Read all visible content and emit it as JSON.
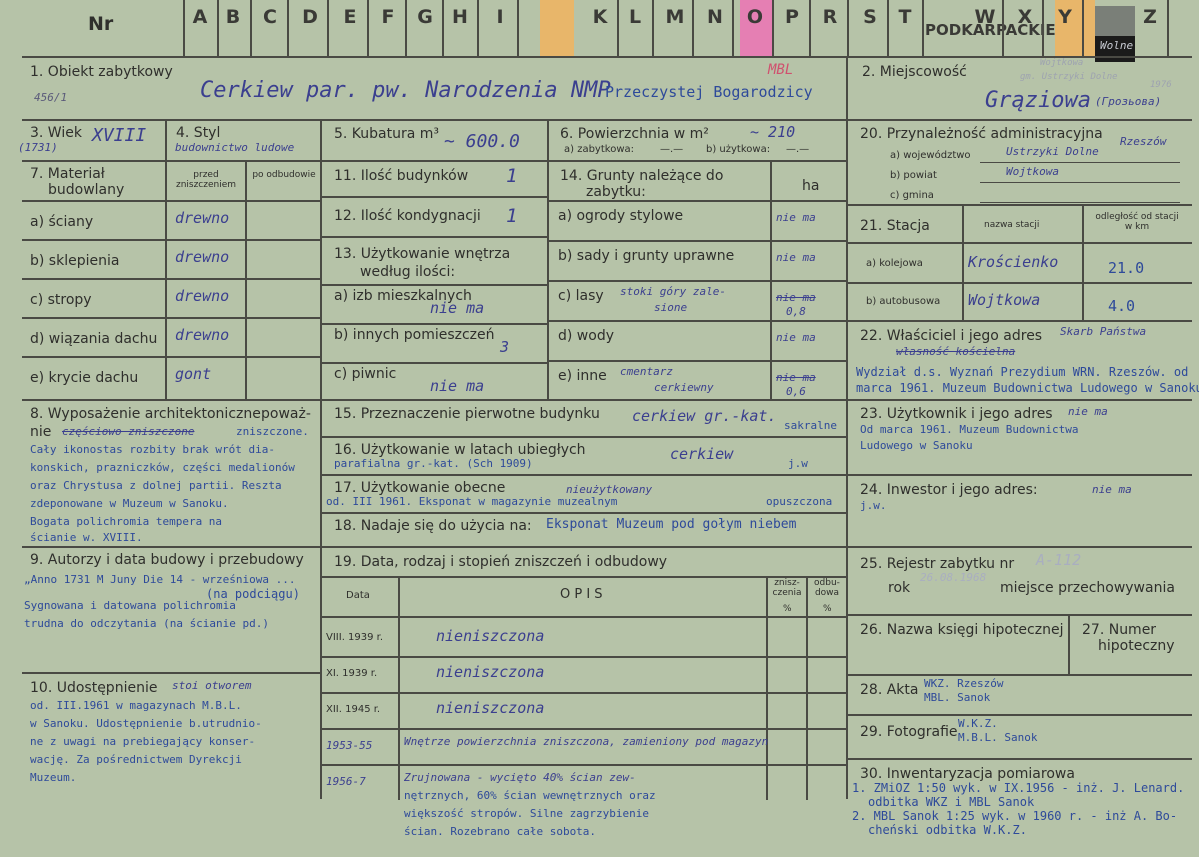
{
  "header": {
    "nr": "Nr",
    "letters": [
      "A",
      "B",
      "C",
      "D",
      "E",
      "F",
      "G",
      "H",
      "I",
      "K",
      "L",
      "M",
      "N",
      "O",
      "P",
      "R",
      "S",
      "T",
      "U",
      "W",
      "X",
      "Y",
      "Z"
    ],
    "stamp": "PODKARPACKIE",
    "corner_note": "Wolne"
  },
  "colors": {
    "paper": "#b6c3a8",
    "ink": "#3b3f8f",
    "orange_tab": "#e8b66a",
    "pink_tab": "#e57fb3",
    "black_tab": "#1b1b1b",
    "gray_tab": "#7a7f78"
  },
  "f1": {
    "label": "1. Obiekt zabytkowy",
    "value": "Cerkiew par. pw. Narodzenia NMP",
    "value2": "Przeczystej Bogarodzicy",
    "num": "456/1",
    "mark": "MBL"
  },
  "f2": {
    "label": "2. Miejscowość",
    "value": "Grąziowa",
    "value2": "(Грозьова)",
    "note": "Wojtkowa",
    "note2": "gm. Ustrzyki Dolne",
    "year": "1976"
  },
  "f3": {
    "label": "3. Wiek",
    "value": "XVIII",
    "note": "(1731)"
  },
  "f4": {
    "label": "4. Styl",
    "value": "budownictwo ludowe"
  },
  "f5": {
    "label": "5. Kubatura m³",
    "value": "~ 600.0"
  },
  "f6": {
    "label": "6. Powierzchnia w m²",
    "value": "~ 210",
    "sub1": "a) zabytkowa:",
    "sub1v": "—.—",
    "sub2": "b) użytkowa:",
    "sub2v": "—.—"
  },
  "f7": {
    "label": "7. Materiał",
    "label2": "budowlany",
    "col1": "przed zniszczeniem",
    "col2": "po odbudowie",
    "rows": [
      {
        "k": "a) ściany",
        "v": "drewno"
      },
      {
        "k": "b) sklepienia",
        "v": "drewno"
      },
      {
        "k": "c) stropy",
        "v": "drewno"
      },
      {
        "k": "d) wiązania dachu",
        "v": "drewno"
      },
      {
        "k": "e) krycie dachu",
        "v": "gont"
      }
    ]
  },
  "f8": {
    "label": "8. Wyposażenie architektoniczne",
    "label_tail": "poważ-",
    "lines": [
      "nie",
      "zniszczone.",
      "Cały ikonostas rozbity brak wrót dia-",
      "konskich, prazniczków, części medalionów",
      "oraz Chrystusa z dolnej partii. Reszta",
      "zdeponowane w Muzeum w Sanoku.",
      "Bogata polichromia tempera na",
      "ścianie w. XVIII."
    ],
    "struck": "częściowo zniszczone"
  },
  "f9": {
    "label": "9. Autorzy i data budowy i przebudowy",
    "line1": "„Anno 1731 M Juny Die 14 - wrześniowa ...",
    "line1b": "(na podciągu)",
    "line2": "Sygnowana i datowana polichromia",
    "line3": "trudna do odczytania (na ścianie pd.)"
  },
  "f10": {
    "label": "10. Udostępnienie",
    "value": "stoi otworem",
    "lines": [
      "od. III.1961 w magazynach M.B.L.",
      "w Sanoku. Udostępnienie b.utrudnio-",
      "ne z uwagi na prebiegający konser-",
      "wację. Za pośrednictwem Dyrekcji",
      "Muzeum."
    ]
  },
  "f11": {
    "label": "11. Ilość budynków",
    "value": "1"
  },
  "f12": {
    "label": "12. Ilość kondygnacji",
    "value": "1"
  },
  "f13": {
    "label": "13. Użytkowanie wnętrza",
    "label2": "według ilości:",
    "rows": [
      {
        "k": "a) izb mieszkalnych",
        "v": "nie ma"
      },
      {
        "k": "b) innych pomieszczeń",
        "v": "3"
      },
      {
        "k": "c) piwnic",
        "v": "nie ma"
      }
    ]
  },
  "f14": {
    "label": "14. Grunty należące do",
    "label2": "zabytku:",
    "unit": "ha",
    "rows": [
      {
        "k": "a) ogrody stylowe",
        "v": "",
        "ha": "nie ma"
      },
      {
        "k": "b) sady i grunty uprawne",
        "v": "",
        "ha": "nie ma"
      },
      {
        "k": "c) lasy",
        "v": "stoki góry zale-",
        "v2": "sione",
        "ha": "nie ma",
        "ha2": "0,8"
      },
      {
        "k": "d) wody",
        "v": "",
        "ha": "nie ma"
      },
      {
        "k": "e) inne",
        "v": "cmentarz",
        "v2": "cerkiewny",
        "ha": "nie ma",
        "ha2": "0,6"
      }
    ]
  },
  "f15": {
    "label": "15. Przeznaczenie pierwotne budynku",
    "value": "cerkiew gr.-kat.",
    "value2": "sakralne"
  },
  "f16": {
    "label": "16. Użytkowanie w latach ubiegłych",
    "value": "cerkiew",
    "sub": "parafialna gr.-kat. (Sch 1909)",
    "tail": "j.w"
  },
  "f17": {
    "label": "17. Użytkowanie obecne",
    "value": "nieużytkowany",
    "sub": "od. III 1961.  Eksponat w magazynie muzealnym",
    "tail": "opuszczona"
  },
  "f18": {
    "label": "18. Nadaje się do użycia na:",
    "value": "Eksponat Muzeum pod gołym niebem"
  },
  "f19": {
    "label": "19. Data, rodzaj i stopień zniszczeń i odbudowy",
    "col_date": "Data",
    "col_opis": "O P I S",
    "col_zn": "znisz-czenia",
    "col_od": "odbu-dowa",
    "pct": "%",
    "rows": [
      {
        "d": "VIII. 1939 r.",
        "o": "nieniszczona"
      },
      {
        "d": "XI. 1939 r.",
        "o": "nieniszczona"
      },
      {
        "d": "XII. 1945 r.",
        "o": "nieniszczona"
      },
      {
        "d": "1953-55",
        "o": "Wnętrze powierzchnia zniszczona, zamieniony pod magazyn"
      },
      {
        "d": "1956-7",
        "o": "Zrujnowana - wycięto 40% ścian zew-"
      }
    ],
    "extra": [
      "nętrznych, 60% ścian wewnętrznych oraz",
      "większość stropów. Silne zagrzybienie",
      "ścian. Rozebrano całe sobota."
    ]
  },
  "f20": {
    "label": "20. Przynależność administracyjna",
    "value": "Rzeszów",
    "rows": [
      {
        "k": "a) województwo",
        "v": "Ustrzyki Dolne"
      },
      {
        "k": "b) powiat",
        "v": "Wojtkowa"
      },
      {
        "k": "c) gmina",
        "v": ""
      }
    ]
  },
  "f21": {
    "label": "21. Stacja",
    "col1": "nazwa stacji",
    "col2": "odległość od stacji w km",
    "rows": [
      {
        "k": "a) kolejowa",
        "v": "Krościenko",
        "km": "21.0"
      },
      {
        "k": "b) autobusowa",
        "v": "Wojtkowa",
        "km": "4.0"
      }
    ]
  },
  "f22": {
    "label": "22. Właściciel i jego adres",
    "value": "Skarb Państwa",
    "struck": "własność kościelna",
    "lines": [
      "Wydział d.s. Wyznań Prezydium WRN. Rzeszów. od",
      "marca 1961. Muzeum Budownictwa Ludowego w Sanoku."
    ]
  },
  "f23": {
    "label": "23. Użytkownik i jego adres",
    "value": "nie ma",
    "lines": [
      "Od marca 1961. Muzeum Budownictwa",
      "Ludowego w Sanoku"
    ]
  },
  "f24": {
    "label": "24. Inwestor i jego adres:",
    "value": "nie ma",
    "value2": "j.w."
  },
  "f25": {
    "label": "25. Rejestr zabytku nr",
    "value": "A-112",
    "rok": "rok",
    "rok_value": "26.08.1968",
    "tail": "miejsce przechowywania"
  },
  "f26": {
    "label": "26. Nazwa księgi hipotecznej"
  },
  "f27": {
    "label": "27. Numer",
    "label2": "hipoteczny"
  },
  "f28": {
    "label": "28. Akta",
    "v1": "WKZ. Rzeszów",
    "v2": "MBL. Sanok"
  },
  "f29": {
    "label": "29. Fotografie",
    "v1": "W.K.Z.",
    "v2": "M.B.L. Sanok"
  },
  "f30": {
    "label": "30. Inwentaryzacja pomiarowa",
    "lines": [
      "1. ZMiOZ 1:50 wyk. w IX.1956 - inż. J. Lenard.",
      "odbitka WKZ i MBL Sanok",
      "2. MBL Sanok 1:25 wyk. w 1960 r. - inż A. Bo-",
      "cheński odbitka W.K.Z."
    ]
  }
}
